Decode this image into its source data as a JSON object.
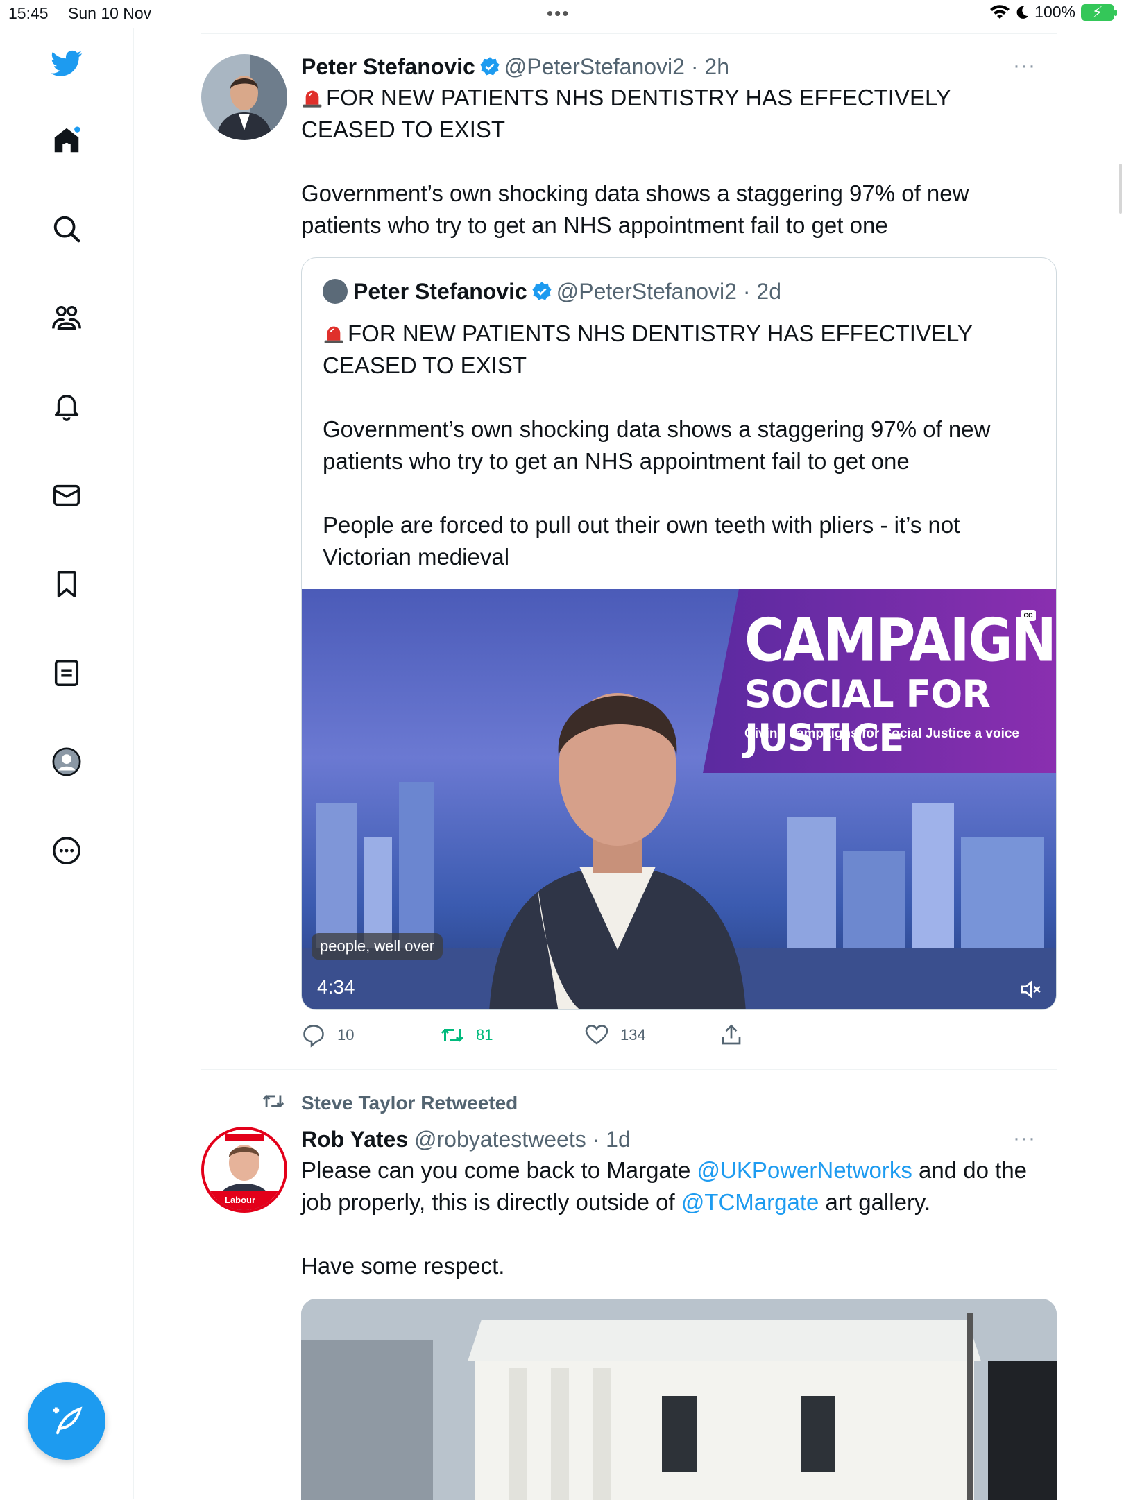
{
  "status_bar": {
    "time": "15:45",
    "date": "Sun 10 Nov",
    "battery": "100%"
  },
  "sidebar": {
    "items": [
      {
        "name": "twitter-logo"
      },
      {
        "name": "home"
      },
      {
        "name": "explore"
      },
      {
        "name": "communities"
      },
      {
        "name": "notifications"
      },
      {
        "name": "messages"
      },
      {
        "name": "bookmarks"
      },
      {
        "name": "lists"
      },
      {
        "name": "profile"
      },
      {
        "name": "more"
      }
    ],
    "accent": "#1d9bf0"
  },
  "tweet1": {
    "name": "Peter Stefanovic",
    "handle": "@PeterStefanovi2",
    "time": "· 2h",
    "more": "···",
    "text_line1": "FOR NEW PATIENTS NHS DENTISTRY HAS EFFECTIVELY CEASED TO EXIST",
    "text_line2": "Government’s own shocking data shows a staggering 97% of new patients who try to get an NHS appointment fail to get one",
    "quote": {
      "name": "Peter Stefanovic",
      "handle": "@PeterStefanovi2",
      "time": "· 2d",
      "p1": "FOR NEW PATIENTS NHS DENTISTRY HAS EFFECTIVELY CEASED TO EXIST",
      "p2": "Government’s own shocking data shows a staggering 97% of new patients who try to get an NHS appointment fail to get one",
      "p3": "People are forced to pull out their own teeth with pliers - it’s not Victorian medieval",
      "video": {
        "banner_title": "CAMPAIGN",
        "banner_subtitle": "SOCIAL FOR JUSTICE",
        "banner_tagline": "Giving campaigns for Social Justice a voice",
        "cc": "CC",
        "caption": "people, well over",
        "duration": "4:34"
      }
    },
    "replies": "10",
    "retweets": "81",
    "likes": "134"
  },
  "tweet2": {
    "retweeted_by": "Steve Taylor Retweeted",
    "name": "Rob Yates",
    "handle": "@robyatestweets",
    "time": "· 1d",
    "more": "···",
    "text_a": "Please can you come back to Margate ",
    "mention1": "@UKPowerNetworks",
    "text_b": " and do the job properly, this is directly outside of ",
    "mention2": "@TCMargate",
    "text_c": " art gallery.",
    "text_d": "Have some respect."
  }
}
